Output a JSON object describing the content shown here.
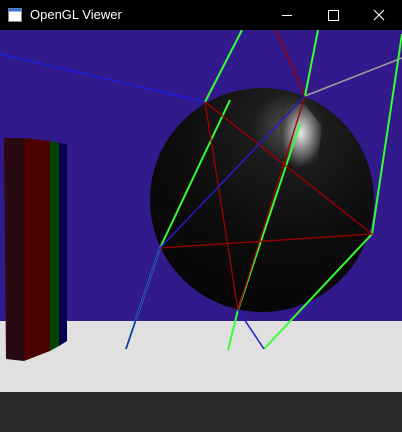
{
  "window": {
    "title": "OpenGL Viewer",
    "app_icon": "app-icon",
    "controls": [
      {
        "name": "minimize-icon"
      },
      {
        "name": "maximize-icon"
      },
      {
        "name": "close-icon"
      }
    ]
  },
  "scene": {
    "background_color": "#331a8c",
    "floor_color": "#e0e0e0",
    "sphere_color": "#0b0b0b",
    "red_line_color": "#a00000",
    "green_line_color": "#33ff33",
    "blue_line_color": "#1e1ecc",
    "pillar_colors": [
      "#2a0a12",
      "#4d0000",
      "#004400",
      "#00004d"
    ]
  }
}
